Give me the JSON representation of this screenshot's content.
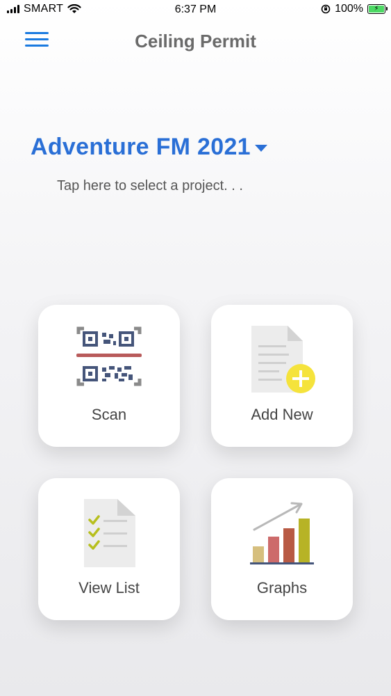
{
  "status_bar": {
    "carrier": "SMART",
    "time": "6:37 PM",
    "battery": "100%"
  },
  "nav": {
    "title": "Ceiling Permit"
  },
  "project": {
    "name": "Adventure FM 2021",
    "hint": "Tap here to select a project. . ."
  },
  "tiles": [
    {
      "label": "Scan",
      "icon": "qr-code-icon"
    },
    {
      "label": "Add New",
      "icon": "add-document-icon"
    },
    {
      "label": "View List",
      "icon": "checklist-icon"
    },
    {
      "label": "Graphs",
      "icon": "bar-chart-icon"
    }
  ],
  "colors": {
    "accent": "#2a6fd6",
    "menu": "#1a7ae0",
    "add_badge": "#f5e33c"
  }
}
